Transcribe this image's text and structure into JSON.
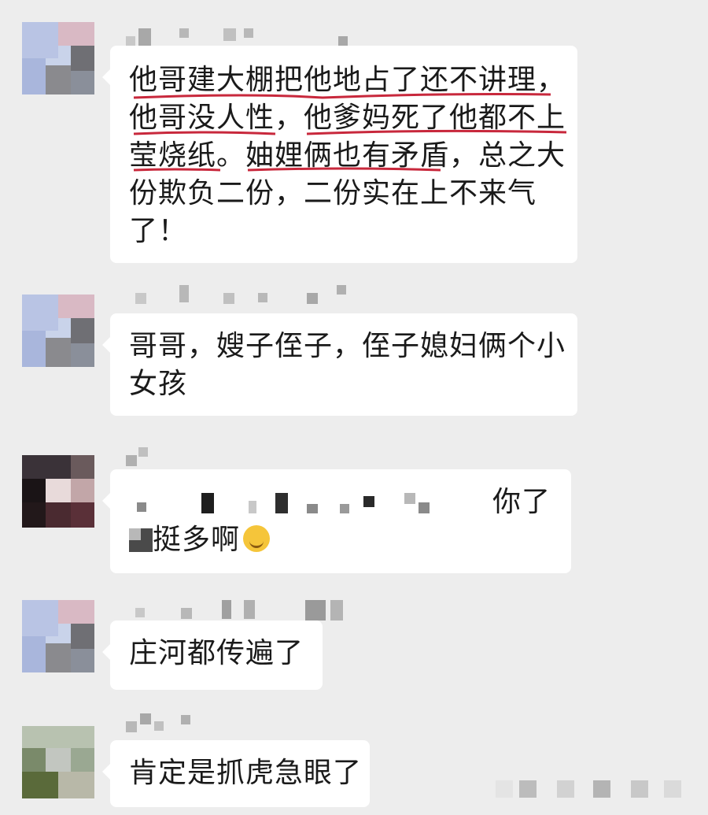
{
  "messages": [
    {
      "lines": [
        "他哥建大棚把他地占了还不讲理，",
        "他哥没人性，他爹妈死了他都不上",
        "莹烧纸。妯娌俩也有矛盾，总之大",
        "份欺负二份，二份实在上不来气",
        "了！"
      ]
    },
    {
      "lines": [
        "哥哥，嫂子侄子，侄子媳妇俩个小",
        "女孩"
      ]
    },
    {
      "tail_text": "你了",
      "line2": "挺多啊"
    },
    {
      "lines": [
        "庄河都传遍了"
      ]
    },
    {
      "lines": [
        "肯定是抓虎急眼了"
      ]
    }
  ],
  "colors": {
    "background": "#ededed",
    "bubble": "#ffffff",
    "underline": "#c8283c",
    "text": "#1a1a1a"
  },
  "icons": {
    "emoji": "grin-emoji-icon"
  }
}
